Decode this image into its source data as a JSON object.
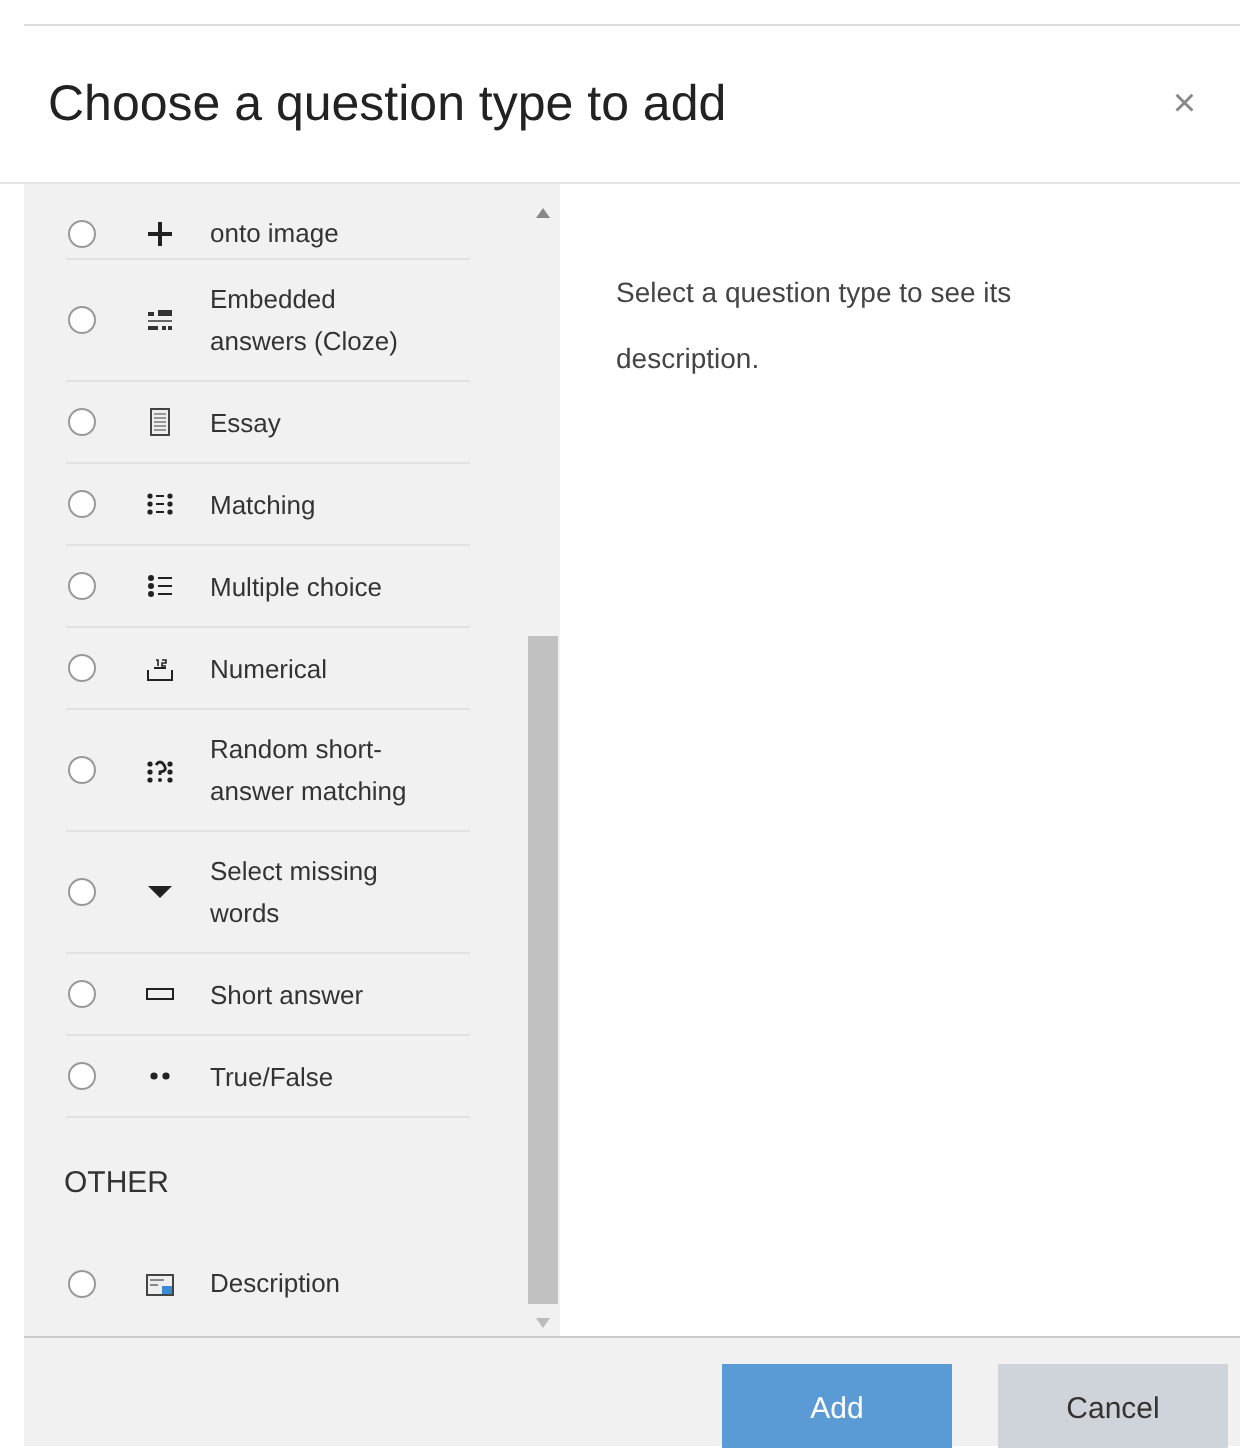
{
  "dialog": {
    "title": "Choose a question type to add",
    "close": "×"
  },
  "groups": [
    {
      "items": [
        {
          "kind": "dragdrop",
          "label": "onto image",
          "selected": false
        },
        {
          "kind": "cloze",
          "label": "Embedded answers (Cloze)",
          "selected": false
        },
        {
          "kind": "essay",
          "label": "Essay",
          "selected": false
        },
        {
          "kind": "matching",
          "label": "Matching",
          "selected": false
        },
        {
          "kind": "multichoice",
          "label": "Multiple choice",
          "selected": false
        },
        {
          "kind": "numerical",
          "label": "Numerical",
          "selected": false
        },
        {
          "kind": "randomsa",
          "label": "Random short-answer matching",
          "selected": false
        },
        {
          "kind": "select",
          "label": "Select missing words",
          "selected": false
        },
        {
          "kind": "shortanswer",
          "label": "Short answer",
          "selected": false
        },
        {
          "kind": "truefalse",
          "label": "True/False",
          "selected": false
        }
      ]
    },
    {
      "heading": "OTHER",
      "items": [
        {
          "kind": "description",
          "label": "Description",
          "selected": false
        }
      ]
    }
  ],
  "description": "Select a question type to see its description.",
  "buttons": [
    {
      "kind": "primary",
      "label": "Add"
    },
    {
      "kind": "secondary",
      "label": "Cancel"
    }
  ]
}
